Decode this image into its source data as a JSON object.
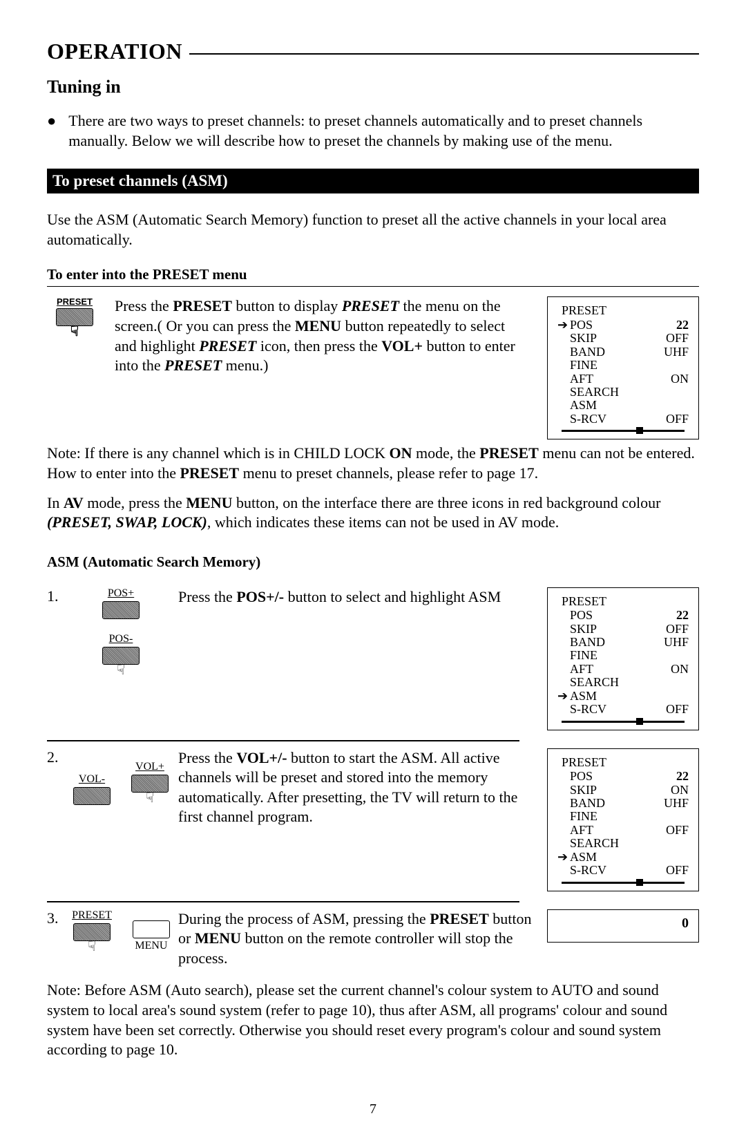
{
  "title": "OPERATION",
  "subtitle": "Tuning in",
  "intro": "There are two ways to preset channels: to preset channels automatically and to preset channels manually. Below we will describe how to preset the channels by making use of the menu.",
  "blackbar1": "To preset channels (ASM)",
  "para1": "Use the ASM (Automatic Search Memory) function to preset all the active channels in your local area automatically.",
  "subhead1": "To enter into the PRESET menu",
  "btn_preset_label": "PRESET",
  "preset_text_parts": {
    "a": "Press the ",
    "b": "PRESET",
    "c": " button to display ",
    "d": "PRESET",
    "e": " the menu on the screen.( Or you can press the ",
    "f": "MENU",
    "g": " button repeatedly to select and highlight ",
    "h": "PRESET",
    "i": " icon, then press the ",
    "j": "VOL+",
    "k": " button to enter into the ",
    "l": "PRESET",
    "m": " menu.)"
  },
  "osd1": {
    "title": "PRESET",
    "selected": 0,
    "rows": [
      {
        "label": "POS",
        "value": "22"
      },
      {
        "label": "SKIP",
        "value": "OFF"
      },
      {
        "label": "BAND",
        "value": "UHF"
      },
      {
        "label": "FINE",
        "value": ""
      },
      {
        "label": "AFT",
        "value": "ON"
      },
      {
        "label": "SEARCH",
        "value": ""
      },
      {
        "label": "ASM",
        "value": ""
      },
      {
        "label": "S-RCV",
        "value": "OFF"
      }
    ]
  },
  "note1_parts": {
    "a": "Note: If there is any channel which is in CHILD LOCK ",
    "b": "ON",
    "c": " mode, the ",
    "d": "PRESET",
    "e": " menu can not be entered. How to enter into the ",
    "f": "PRESET",
    "g": " menu to preset channels, please refer to page 17."
  },
  "av_parts": {
    "a": "In ",
    "b": "AV",
    "c": " mode, press the ",
    "d": "MENU",
    "e": " button, on the interface there are three icons in red background colour ",
    "f": "(PRESET, SWAP, LOCK)",
    "g": ", which indicates these items can not be used in AV mode."
  },
  "subhead2": "ASM (Automatic Search Memory)",
  "step1": {
    "num": "1.",
    "btn_top": "POS+",
    "btn_bottom": "POS-",
    "text_a": "Press the ",
    "text_b": "POS+/-",
    "text_c": " button to select and highlight ASM"
  },
  "osd2": {
    "title": "PRESET",
    "selected": 6,
    "rows": [
      {
        "label": "POS",
        "value": "22"
      },
      {
        "label": "SKIP",
        "value": "OFF"
      },
      {
        "label": "BAND",
        "value": "UHF"
      },
      {
        "label": "FINE",
        "value": ""
      },
      {
        "label": "AFT",
        "value": "ON"
      },
      {
        "label": "SEARCH",
        "value": ""
      },
      {
        "label": "ASM",
        "value": ""
      },
      {
        "label": "S-RCV",
        "value": "OFF"
      }
    ]
  },
  "step2": {
    "num": "2.",
    "btn_left": "VOL-",
    "btn_right": "VOL+",
    "text_a": "Press the ",
    "text_b": "VOL+/-",
    "text_c": " button to start the ASM. All active channels will be preset and stored into the memory automatically. After presetting, the TV will return to the first channel program."
  },
  "osd3": {
    "title": "PRESET",
    "selected": 6,
    "rows": [
      {
        "label": "POS",
        "value": "22"
      },
      {
        "label": "SKIP",
        "value": "ON"
      },
      {
        "label": "BAND",
        "value": "UHF"
      },
      {
        "label": "FINE",
        "value": ""
      },
      {
        "label": "AFT",
        "value": "OFF"
      },
      {
        "label": "SEARCH",
        "value": ""
      },
      {
        "label": "ASM",
        "value": ""
      },
      {
        "label": "S-RCV",
        "value": "OFF"
      }
    ]
  },
  "step3": {
    "num": "3.",
    "btn_left": "PRESET",
    "btn_right": "MENU",
    "text_a": "During the process of ASM, pressing the ",
    "text_b": "PRESET",
    "text_c": " button or ",
    "text_d": "MENU",
    "text_e": " button on the remote controller will stop the process."
  },
  "osd4": {
    "value": "0"
  },
  "note2": "Note: Before ASM (Auto search), please set the current channel's colour system to AUTO and sound system to local area's sound system (refer to page 10), thus after ASM, all programs' colour and sound system have been set correctly. Otherwise you should reset every program's colour and sound system according to page 10.",
  "page_number": "7"
}
